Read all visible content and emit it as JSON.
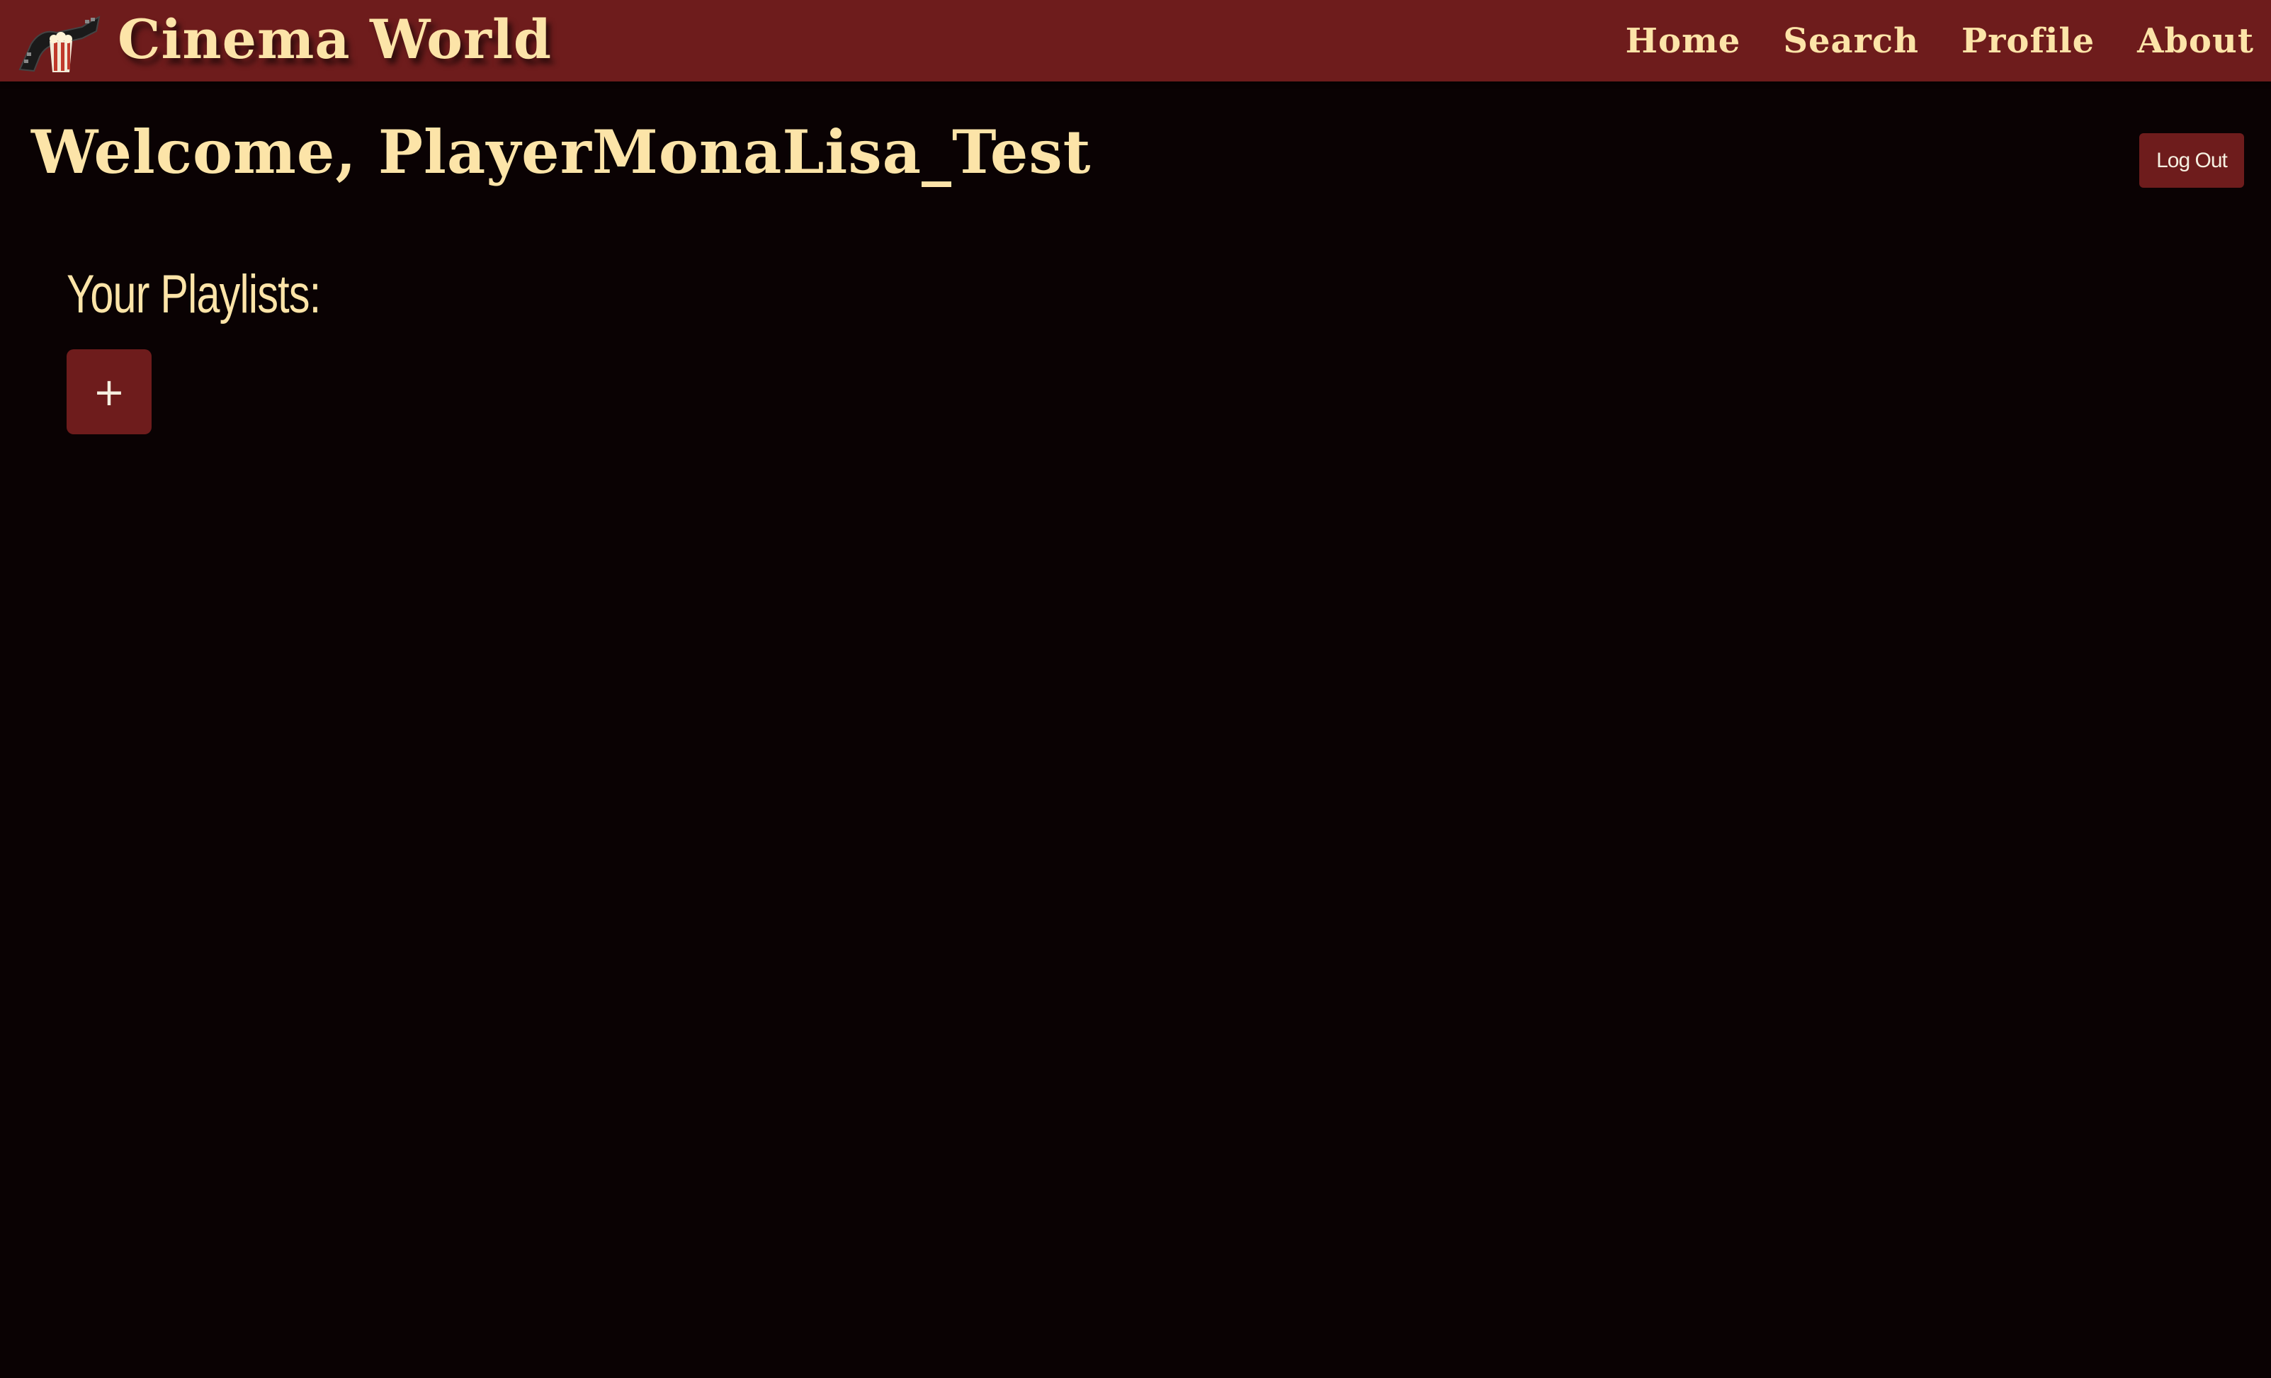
{
  "header": {
    "brand": "Cinema World",
    "logo_icon": "film-reel-popcorn-icon",
    "nav": [
      {
        "label": "Home"
      },
      {
        "label": "Search"
      },
      {
        "label": "Profile"
      },
      {
        "label": "About"
      }
    ]
  },
  "main": {
    "welcome": "Welcome, PlayerMonaLisa_Test",
    "logout_label": "Log Out",
    "playlists_heading": "Your Playlists:",
    "add_playlist_label": "+"
  },
  "colors": {
    "header_bg": "#6e1c1c",
    "page_bg": "#0a0203",
    "accent_text": "#fce4a8",
    "button_bg": "#6e1c1c"
  }
}
